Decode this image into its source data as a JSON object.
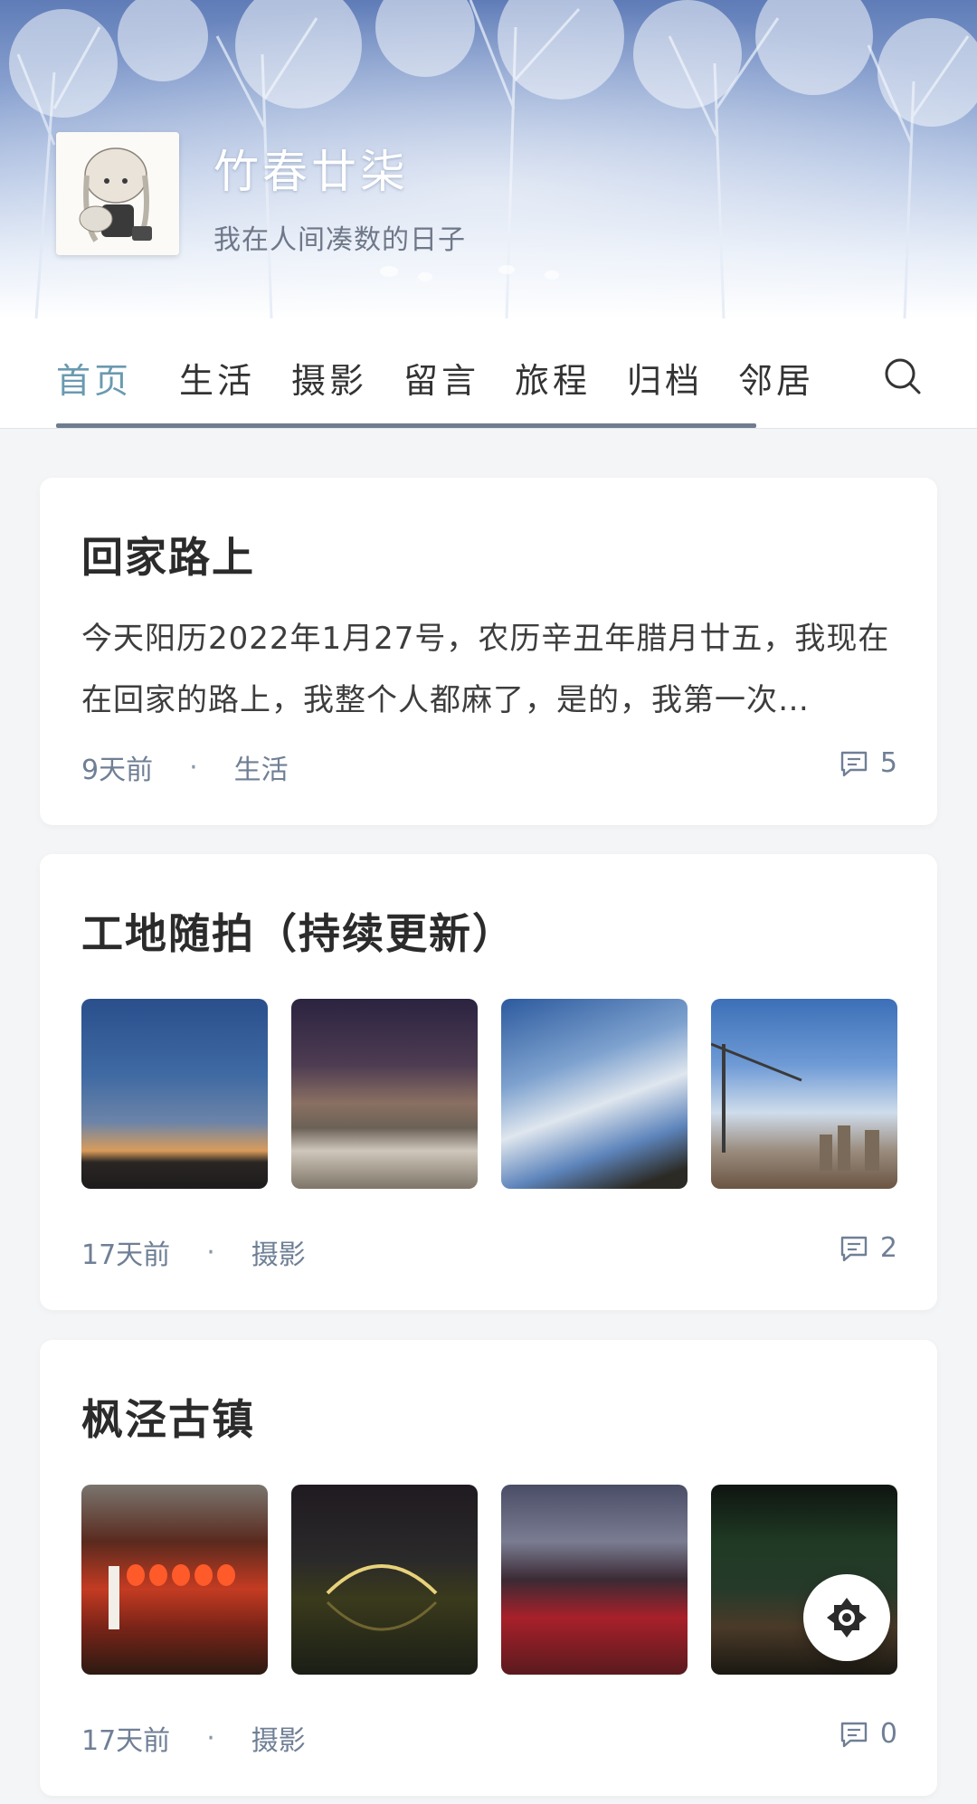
{
  "header": {
    "title": "竹春廿柒",
    "subtitle": "我在人间凑数的日子"
  },
  "nav": {
    "items": [
      {
        "label": "首页",
        "active": true
      },
      {
        "label": "生活",
        "active": false
      },
      {
        "label": "摄影",
        "active": false
      },
      {
        "label": "留言",
        "active": false
      },
      {
        "label": "旅程",
        "active": false
      },
      {
        "label": "归档",
        "active": false
      },
      {
        "label": "邻居",
        "active": false
      }
    ],
    "search_icon": "search-icon"
  },
  "posts": [
    {
      "title": "回家路上",
      "excerpt": "今天阳历2022年1月27号，农历辛丑年腊月廿五，我现在在回家的路上，我整个人都麻了，是的，我第一次…",
      "time": "9天前",
      "category": "生活",
      "comments": "5"
    },
    {
      "title": "工地随拍（持续更新）",
      "time": "17天前",
      "category": "摄影",
      "comments": "2",
      "thumbnails": [
        "dusk-sky-photo",
        "excavator-night-photo",
        "cloudy-sky-photo",
        "tower-crane-photo"
      ]
    },
    {
      "title": "枫泾古镇",
      "time": "17天前",
      "category": "摄影",
      "comments": "0",
      "thumbnails": [
        "lantern-shop-photo",
        "stone-bridge-night-photo",
        "red-lit-canal-photo",
        "riverside-night-photo"
      ]
    }
  ],
  "fab_icon": "theme-toggle-icon",
  "colors": {
    "accent": "#6a9ab0",
    "underline": "#6f7c90",
    "meta": "#6f7f95",
    "background": "#f4f5f7"
  }
}
